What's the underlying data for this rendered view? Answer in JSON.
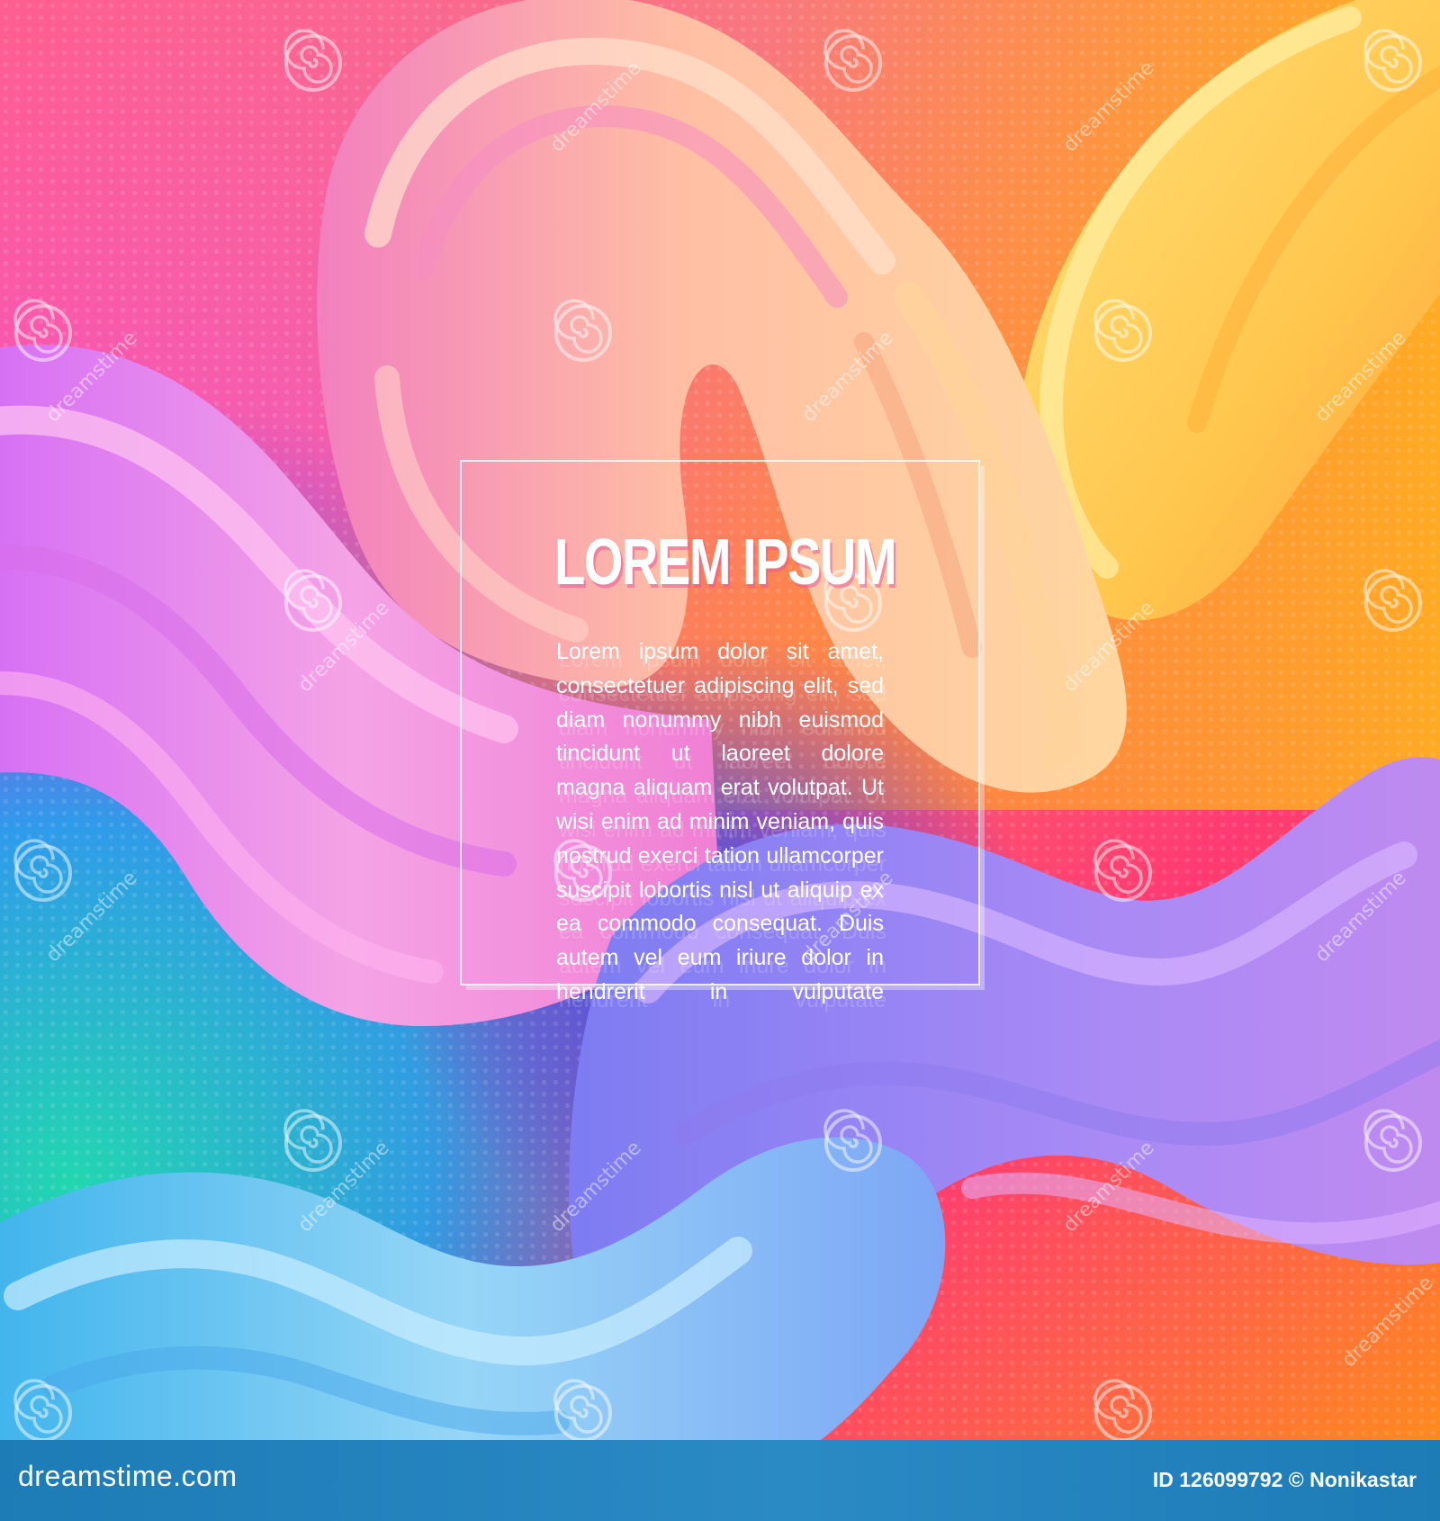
{
  "poster": {
    "headline": "LOREM IPSUM",
    "body": "Lorem ipsum dolor sit amet, consectetuer adipiscing elit, sed diam nonummy nibh euismod tincidunt ut laoreet dolore magna aliquam erat volutpat. Ut wisi enim ad minim veniam, quis nostrud exerci tation ullamcorper suscipit lobortis nisl ut aliquip ex ea commodo consequat. Duis autem vel eum iriure dolor in hendrerit in vulputate",
    "watermark_text": "dreamstime"
  },
  "footer": {
    "brand": "dreamstime.com",
    "image_id": "ID 126099792 © Nonikastar"
  },
  "colors": {
    "background_top_left": "#ff5f8f",
    "background_top_right": "#ffb020",
    "background_bottom_left": "#19b6e8",
    "background_bottom_right": "#ff8a1e",
    "ribbon_pink": "#f29fe0",
    "ribbon_peach": "#ffc09a",
    "ribbon_yellow": "#ffe17a",
    "ribbon_violet": "#c58cf2",
    "ribbon_blue": "#86d2f5",
    "footer": "#1d7bb6"
  }
}
